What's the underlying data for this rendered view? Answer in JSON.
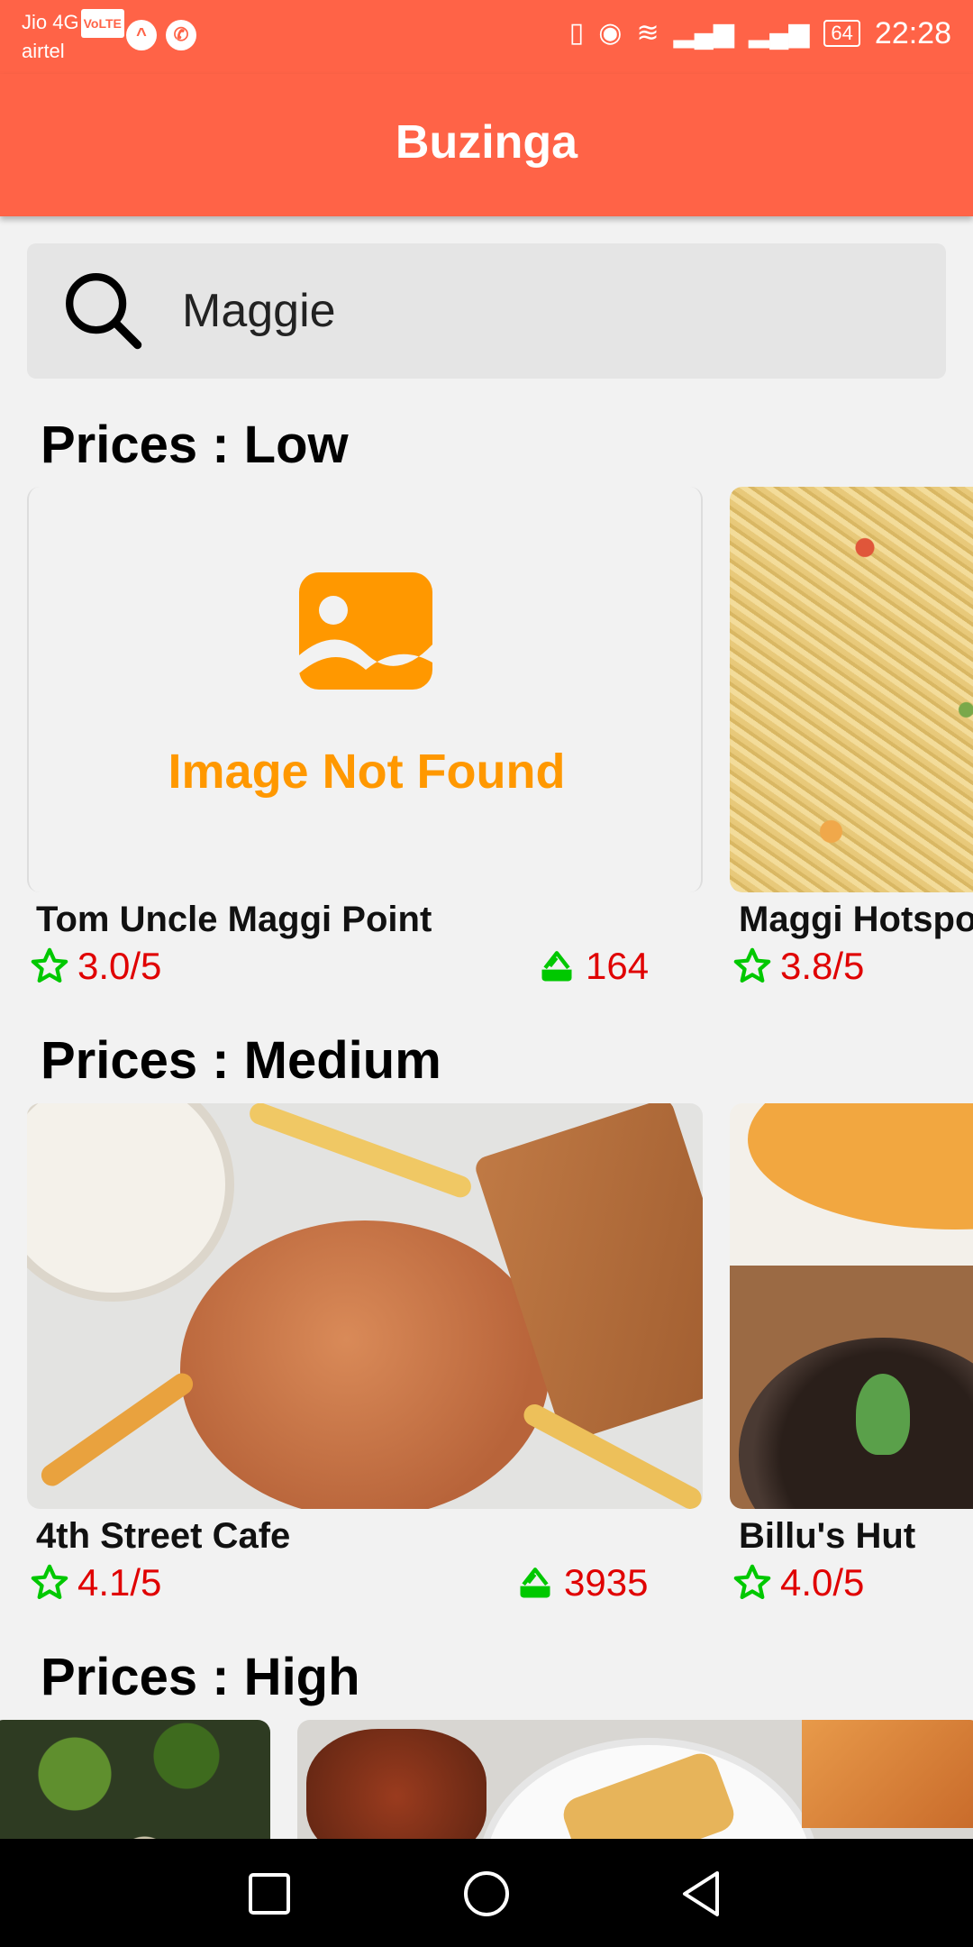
{
  "status_bar": {
    "carrier1": "Jio 4G",
    "volte": "VoLTE",
    "carrier2": "airtel",
    "battery": "64",
    "time": "22:28"
  },
  "app_bar": {
    "title": "Buzinga"
  },
  "search": {
    "value": "Maggie",
    "icon": "search-icon"
  },
  "sections": [
    {
      "title": "Prices : Low",
      "cards": [
        {
          "name": "Tom Uncle Maggi Point",
          "rating": "3.0/5",
          "count": "164",
          "image": "image-not-found",
          "placeholder_text": "Image Not Found"
        },
        {
          "name": "Maggi Hotspot",
          "rating": "3.8/5",
          "image": "maggi-noodles-photo"
        }
      ]
    },
    {
      "title": "Prices : Medium",
      "cards": [
        {
          "name": "4th Street Cafe",
          "rating": "4.1/5",
          "count": "3935",
          "image": "burger-fries-sandwich-photo"
        },
        {
          "name": "Billu's Hut",
          "rating": "4.0/5",
          "image": "dessert-pasta-photo"
        }
      ]
    },
    {
      "title": "Prices : High",
      "cards": [
        {
          "image": "broccoli-dish-photo"
        },
        {
          "image": "chicken-platter-photo"
        }
      ]
    }
  ],
  "colors": {
    "accent": "#ff6347",
    "rating_text": "#e00000",
    "icon_green": "#00c800",
    "placeholder_orange": "#ff9800"
  }
}
